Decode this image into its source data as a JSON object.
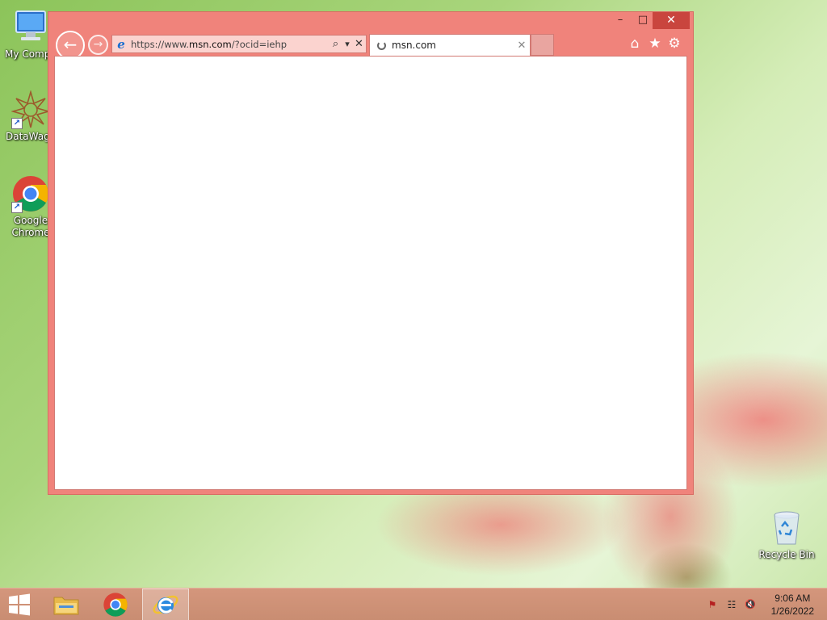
{
  "desktop": {
    "icons": [
      {
        "label": "My Compu",
        "icon": "computer-icon"
      },
      {
        "label": "DataWago",
        "icon": "datawagon-icon"
      },
      {
        "label_line1": "Google",
        "label_line2": "Chrome",
        "icon": "chrome-icon"
      },
      {
        "label": "Recycle Bin",
        "icon": "recycle-bin-icon"
      }
    ]
  },
  "browser": {
    "caption": {
      "minimize": "–",
      "maximize": "□",
      "close": "✕"
    },
    "nav": {
      "back": "←",
      "forward": "→"
    },
    "address": {
      "url_prefix": "https://www.",
      "url_domain": "msn.com",
      "url_suffix": "/?ocid=iehp",
      "search_icon": "⌕",
      "dropdown_icon": "▾",
      "stop_icon": "✕"
    },
    "tab": {
      "title": "msn.com",
      "close": "✕"
    },
    "commands": {
      "home": "⌂",
      "favorites": "★",
      "tools": "⚙"
    },
    "accent_color": "#f0837b"
  },
  "taskbar": {
    "pinned": [
      "start-button",
      "file-explorer",
      "google-chrome",
      "internet-explorer"
    ],
    "active": "internet-explorer",
    "tray": {
      "flag": "⚑",
      "network": "☷",
      "volume": "🔇"
    },
    "clock": {
      "time": "9:06 AM",
      "date": "1/26/2022"
    }
  }
}
